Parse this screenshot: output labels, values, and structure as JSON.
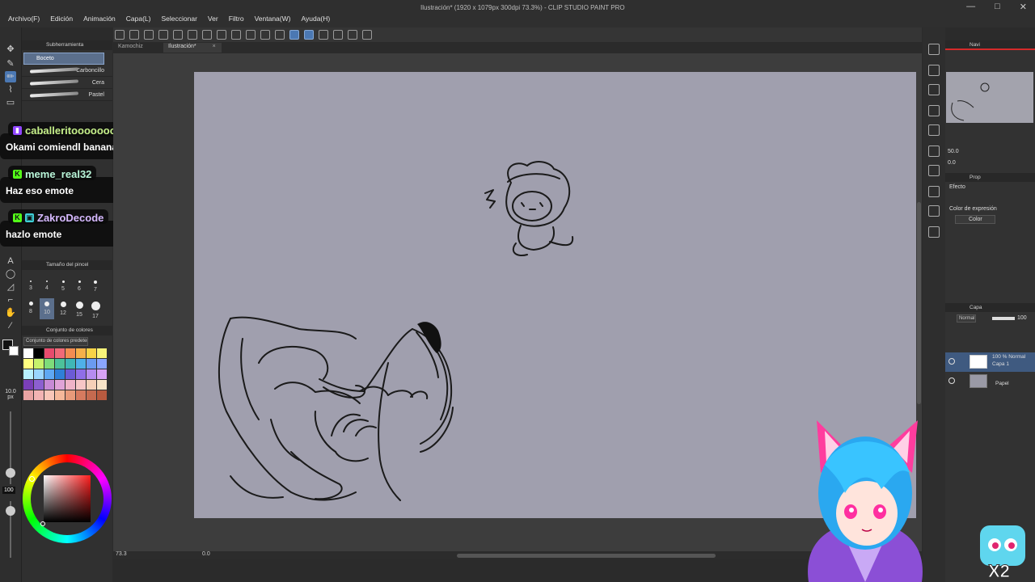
{
  "window": {
    "title": "Ilustración* (1920 x 1079px 300dpi 73.3%) - CLIP STUDIO PAINT PRO",
    "controls": [
      "—",
      "□",
      "✕"
    ]
  },
  "menu": [
    "Archivo(F)",
    "Edición",
    "Animación",
    "Capa(L)",
    "Seleccionar",
    "Ver",
    "Filtro",
    "Ventana(W)",
    "Ayuda(H)"
  ],
  "tabs": [
    {
      "label": "Kamochiz",
      "active": false
    },
    {
      "label": "Ilustración*",
      "active": true
    }
  ],
  "subtool": {
    "header": "Subherramienta",
    "selected": "Boceto",
    "brushes": [
      "Carboncillo",
      "Cera",
      "Pastel"
    ]
  },
  "chat": [
    {
      "user": "caballeritooooooo",
      "color": "#c6f08a",
      "badge": "twitch-icon",
      "message": "Okami comiendl banana 🍌"
    },
    {
      "user": "meme_real32",
      "color": "#b8f5d8",
      "badge": "kick-icon",
      "message": "Haz eso emote"
    },
    {
      "user": "ZakroDecode",
      "color": "#d6b9ff",
      "badge": "kick-icon",
      "message": "hazlo emote"
    }
  ],
  "brush_size": {
    "header": "Tamaño del pincel",
    "sizes": [
      "3",
      "4",
      "5",
      "6",
      "7",
      "8",
      "10",
      "12",
      "15",
      "17"
    ],
    "selected": "10"
  },
  "color_set": {
    "header": "Conjunto de colores",
    "dropdown": "Conjunto de colores predeterm",
    "swatches": [
      "#ffffff",
      "#000000",
      "#e84b6d",
      "#f06a78",
      "#f28d52",
      "#f5b04a",
      "#f7d347",
      "#f8f37a",
      "#ffff80",
      "#c6f26b",
      "#7edc7a",
      "#4cc29a",
      "#3fb6b6",
      "#4fb0e8",
      "#6b9bf0",
      "#8aa5ff",
      "#b8f0ff",
      "#9ad6ff",
      "#5fa8f2",
      "#2f7fd8",
      "#6b5bd6",
      "#8f6ee8",
      "#b68cf0",
      "#d7a3f5",
      "#7a3fb8",
      "#8c5fd0",
      "#c78ad6",
      "#e0a3d8",
      "#f0b3c8",
      "#f7c6c6",
      "#f5d0b8",
      "#f8e3c8",
      "#e8a3a3",
      "#f2b3b3",
      "#f8c6b8",
      "#f5b89a",
      "#e89a7a",
      "#d67a5f",
      "#c56a4f",
      "#b85a3f"
    ]
  },
  "size_readout": "10.0",
  "size_unit": "px",
  "opacity_readout": "100",
  "zoom_readout": "73.3",
  "rotation_readout": "0.0",
  "navigator": {
    "header": "Navi"
  },
  "nav_zoom": "50.0",
  "nav_angle": "0.0",
  "properties": {
    "header": "Prop",
    "effect": "Efecto",
    "expression_label": "Color de expresión",
    "expression_value": "Color"
  },
  "layers": {
    "header": "Capa",
    "blend": "Normal",
    "opacity": "100",
    "items": [
      {
        "name": "Capa 1",
        "info": "100 % Normal",
        "selected": true
      },
      {
        "name": "Papel",
        "info": "",
        "selected": false
      }
    ]
  }
}
